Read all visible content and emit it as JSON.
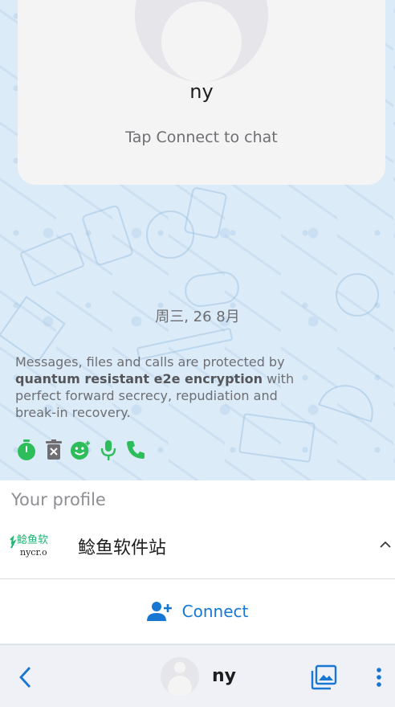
{
  "contact": {
    "name": "ny",
    "hint": "Tap Connect to chat"
  },
  "chat": {
    "date_separator": "周三, 26 8月",
    "e2e_prefix": "Messages, files and calls are protected by ",
    "e2e_bold": "quantum resistant e2e encryption",
    "e2e_suffix": " with perfect forward secrecy, repudiation and break-in recovery.",
    "features": [
      {
        "icon": "timer-icon"
      },
      {
        "icon": "delete-message-icon"
      },
      {
        "icon": "add-reaction-icon"
      },
      {
        "icon": "microphone-icon"
      },
      {
        "icon": "phone-icon"
      }
    ],
    "feature_color": "#2ebd5b"
  },
  "profile": {
    "section_title": "Your profile",
    "logo_text": "鲶鱼软",
    "logo_subtext": "nycr.o",
    "name": "鲶鱼软件站"
  },
  "connect": {
    "label": "Connect",
    "color": "#1877d2"
  },
  "bottom_bar": {
    "title": "ny"
  }
}
